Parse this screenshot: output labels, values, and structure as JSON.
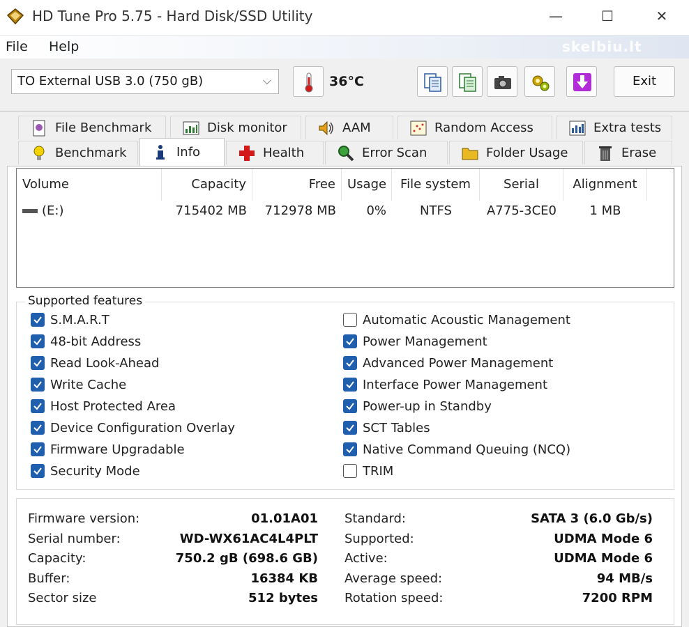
{
  "window": {
    "title": "HD Tune Pro 5.75 - Hard Disk/SSD Utility",
    "minimize_glyph": "—",
    "maximize_glyph": "☐",
    "close_glyph": "✕"
  },
  "menu": {
    "file": "File",
    "help": "Help",
    "watermark": "skelbiu.lt"
  },
  "toolbar": {
    "drive": "TO External USB 3.0 (750 gB)",
    "temperature": "36°C",
    "exit_label": "Exit",
    "icons": [
      "copy-info-icon",
      "copy-text-icon",
      "screenshot-icon",
      "options-icon",
      "save-icon"
    ]
  },
  "tabs": {
    "row1": [
      {
        "label": "File Benchmark",
        "icon": "file-benchmark-icon"
      },
      {
        "label": "Disk monitor",
        "icon": "disk-monitor-icon"
      },
      {
        "label": "AAM",
        "icon": "speaker-icon"
      },
      {
        "label": "Random Access",
        "icon": "random-access-icon"
      },
      {
        "label": "Extra tests",
        "icon": "extra-tests-icon"
      }
    ],
    "row2": [
      {
        "label": "Benchmark",
        "icon": "benchmark-icon"
      },
      {
        "label": "Info",
        "icon": "info-icon"
      },
      {
        "label": "Health",
        "icon": "health-cross-icon"
      },
      {
        "label": "Error Scan",
        "icon": "magnifier-icon"
      },
      {
        "label": "Folder Usage",
        "icon": "folder-icon"
      },
      {
        "label": "Erase",
        "icon": "trash-icon"
      }
    ],
    "active": "Info"
  },
  "volumes": {
    "headers": [
      "Volume",
      "Capacity",
      "Free",
      "Usage",
      "File system",
      "Serial",
      "Alignment"
    ],
    "rows": [
      [
        "(E:)",
        "715402 MB",
        "712978 MB",
        "0%",
        "NTFS",
        "A775-3CE0",
        "1 MB"
      ]
    ]
  },
  "features": {
    "legend": "Supported features",
    "left": [
      {
        "label": "S.M.A.R.T",
        "checked": true
      },
      {
        "label": "48-bit Address",
        "checked": true
      },
      {
        "label": "Read Look-Ahead",
        "checked": true
      },
      {
        "label": "Write Cache",
        "checked": true
      },
      {
        "label": "Host Protected Area",
        "checked": true
      },
      {
        "label": "Device Configuration Overlay",
        "checked": true
      },
      {
        "label": "Firmware Upgradable",
        "checked": true
      },
      {
        "label": "Security Mode",
        "checked": true
      }
    ],
    "right": [
      {
        "label": "Automatic Acoustic Management",
        "checked": false
      },
      {
        "label": "Power Management",
        "checked": true
      },
      {
        "label": "Advanced Power Management",
        "checked": true
      },
      {
        "label": "Interface Power Management",
        "checked": true
      },
      {
        "label": "Power-up in Standby",
        "checked": true
      },
      {
        "label": "SCT Tables",
        "checked": true
      },
      {
        "label": "Native Command Queuing (NCQ)",
        "checked": true
      },
      {
        "label": "TRIM",
        "checked": false
      }
    ]
  },
  "info": {
    "left": [
      {
        "label": "Firmware version:",
        "value": "01.01A01"
      },
      {
        "label": "Serial number:",
        "value": "WD-WX61AC4L4PLT"
      },
      {
        "label": "Capacity:",
        "value": "750.2 gB (698.6 GB)"
      },
      {
        "label": "Buffer:",
        "value": "16384 KB"
      },
      {
        "label": "Sector size",
        "value": "512 bytes"
      }
    ],
    "right": [
      {
        "label": "Standard:",
        "value": "SATA 3 (6.0 Gb/s)"
      },
      {
        "label": "Supported:",
        "value": "UDMA Mode 6"
      },
      {
        "label": "Active:",
        "value": "UDMA Mode 6"
      },
      {
        "label": "Average speed:",
        "value": "94 MB/s"
      },
      {
        "label": "Rotation speed:",
        "value": "7200 RPM"
      }
    ]
  },
  "colors": {
    "checkbox_on": "#1f5fae",
    "tab_active_bg": "#ffffff",
    "window_bg": "#f0f0f0"
  }
}
